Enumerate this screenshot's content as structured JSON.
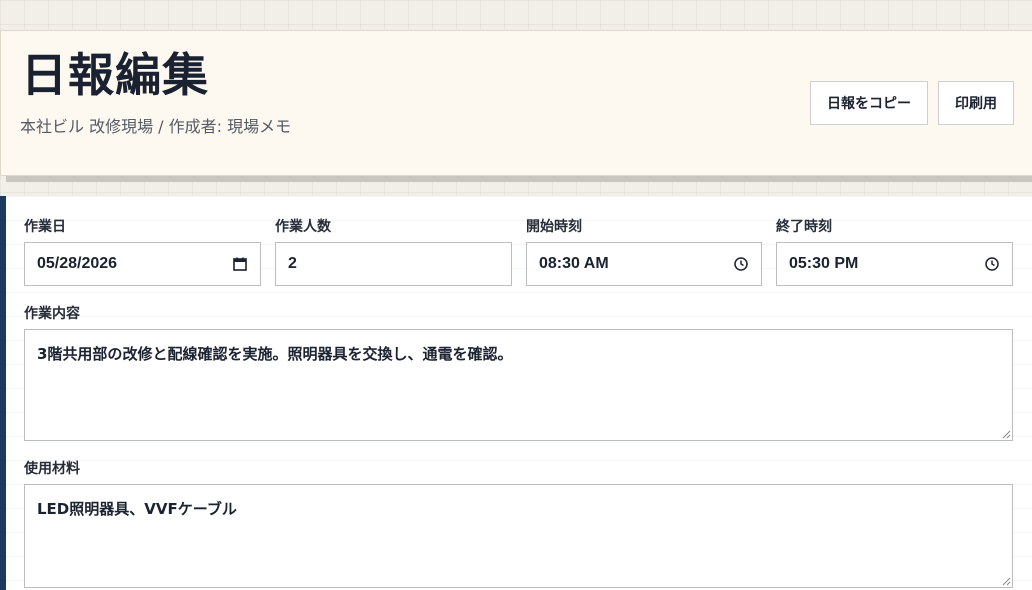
{
  "header": {
    "title": "日報編集",
    "subtitle": "本社ビル 改修現場 / 作成者: 現場メモ",
    "copy_label": "日報をコピー",
    "print_label": "印刷用"
  },
  "form": {
    "work_date": {
      "label": "作業日",
      "value": "05/28/2026",
      "icon": "calendar-icon"
    },
    "workers": {
      "label": "作業人数",
      "value": "2"
    },
    "start_time": {
      "label": "開始時刻",
      "value": "08:30 AM",
      "icon": "clock-icon"
    },
    "end_time": {
      "label": "終了時刻",
      "value": "05:30 PM",
      "icon": "clock-icon"
    },
    "content": {
      "label": "作業内容",
      "value": "3階共用部の改修と配線確認を実施。照明器具を交換し、通電を確認。"
    },
    "materials": {
      "label": "使用材料",
      "value": "LED照明器具、VVFケーブル"
    }
  },
  "colors": {
    "accent": "#1d3a5e",
    "header_bg": "#fdf9f0",
    "page_bg": "#f2efe8"
  }
}
